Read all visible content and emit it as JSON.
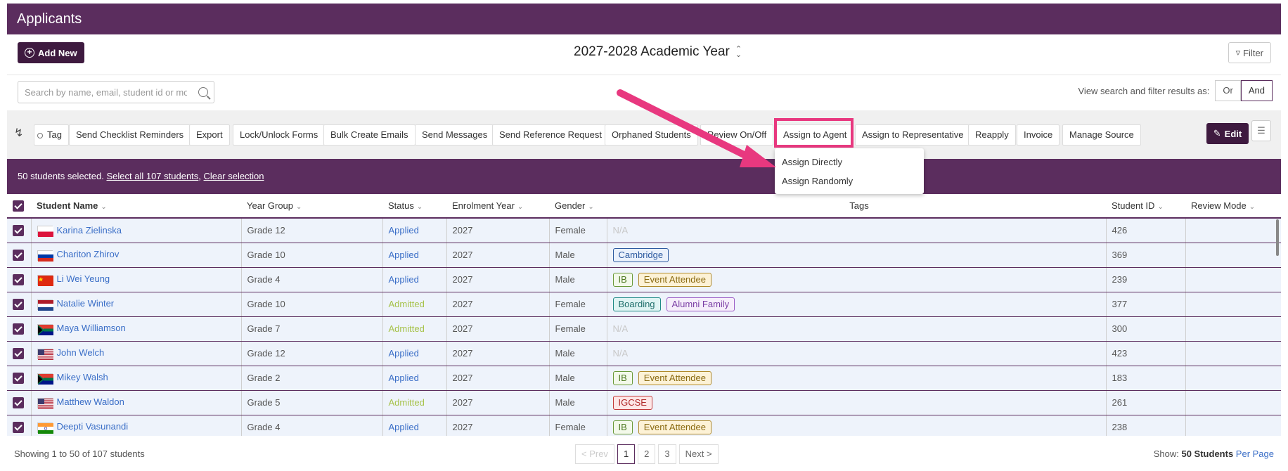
{
  "header": {
    "title": "Applicants"
  },
  "top": {
    "add_label": "Add New",
    "year_label": "2027-2028 Academic Year",
    "filter_label": "Filter"
  },
  "search": {
    "placeholder": "Search by name, email, student id or mobi",
    "view_as_label": "View search and filter results as:",
    "or_label": "Or",
    "and_label": "And"
  },
  "toolbar": {
    "buttons": [
      "Tag",
      "Send Checklist Reminders",
      "Export",
      "Lock/Unlock Forms",
      "Bulk Create Emails",
      "Send Messages",
      "Send Reference Request",
      "Orphaned Students",
      "Review On/Off",
      "Assign to Agent",
      "Assign to Representative",
      "Reapply",
      "Invoice",
      "Manage Source"
    ],
    "edit_label": "Edit"
  },
  "dropdown": {
    "items": [
      "Assign Directly",
      "Assign Randomly"
    ]
  },
  "selection": {
    "text": "50 students selected.",
    "select_all": "Select all 107 students",
    "clear": "Clear selection"
  },
  "table": {
    "headers": [
      "Student Name",
      "Year Group",
      "Status",
      "Enrolment Year",
      "Gender",
      "Tags",
      "Student ID",
      "Review Mode"
    ],
    "rows": [
      {
        "name": "Karina Zielinska",
        "flag": "poland",
        "year": "Grade 12",
        "status": "Applied",
        "enrol": "2027",
        "gender": "Female",
        "tags": [],
        "id": "426"
      },
      {
        "name": "Chariton Zhirov",
        "flag": "russia",
        "year": "Grade 10",
        "status": "Applied",
        "enrol": "2027",
        "gender": "Male",
        "tags": [
          "Cambridge"
        ],
        "id": "369"
      },
      {
        "name": "Li Wei Yeung",
        "flag": "china",
        "year": "Grade 4",
        "status": "Applied",
        "enrol": "2027",
        "gender": "Male",
        "tags": [
          "IB",
          "Event Attendee"
        ],
        "id": "239"
      },
      {
        "name": "Natalie Winter",
        "flag": "netherlands",
        "year": "Grade 10",
        "status": "Admitted",
        "enrol": "2027",
        "gender": "Female",
        "tags": [
          "Boarding",
          "Alumni Family"
        ],
        "id": "377"
      },
      {
        "name": "Maya Williamson",
        "flag": "south-africa",
        "year": "Grade 7",
        "status": "Admitted",
        "enrol": "2027",
        "gender": "Female",
        "tags": [],
        "id": "300"
      },
      {
        "name": "John Welch",
        "flag": "usa",
        "year": "Grade 12",
        "status": "Applied",
        "enrol": "2027",
        "gender": "Male",
        "tags": [],
        "id": "423"
      },
      {
        "name": "Mikey Walsh",
        "flag": "south-africa",
        "year": "Grade 2",
        "status": "Applied",
        "enrol": "2027",
        "gender": "Male",
        "tags": [
          "IB",
          "Event Attendee"
        ],
        "id": "183"
      },
      {
        "name": "Matthew Waldon",
        "flag": "usa",
        "year": "Grade 5",
        "status": "Admitted",
        "enrol": "2027",
        "gender": "Male",
        "tags": [
          "IGCSE"
        ],
        "id": "261"
      },
      {
        "name": "Deepti Vasunandi",
        "flag": "india",
        "year": "Grade 4",
        "status": "Applied",
        "enrol": "2027",
        "gender": "Female",
        "tags": [
          "IB",
          "Event Attendee"
        ],
        "id": "238"
      }
    ],
    "empty_tag": "N/A"
  },
  "footer": {
    "showing": "Showing 1 to 50 of 107 students",
    "prev": "< Prev",
    "pages": [
      "1",
      "2",
      "3"
    ],
    "next": "Next >",
    "show_label": "Show:",
    "show_count": "50 Students",
    "per_page": "Per Page"
  },
  "colors": {
    "brand": "#5b2d5e",
    "highlight": "#e8387f",
    "link": "#3a6ec7",
    "admitted": "#a6c24a"
  }
}
